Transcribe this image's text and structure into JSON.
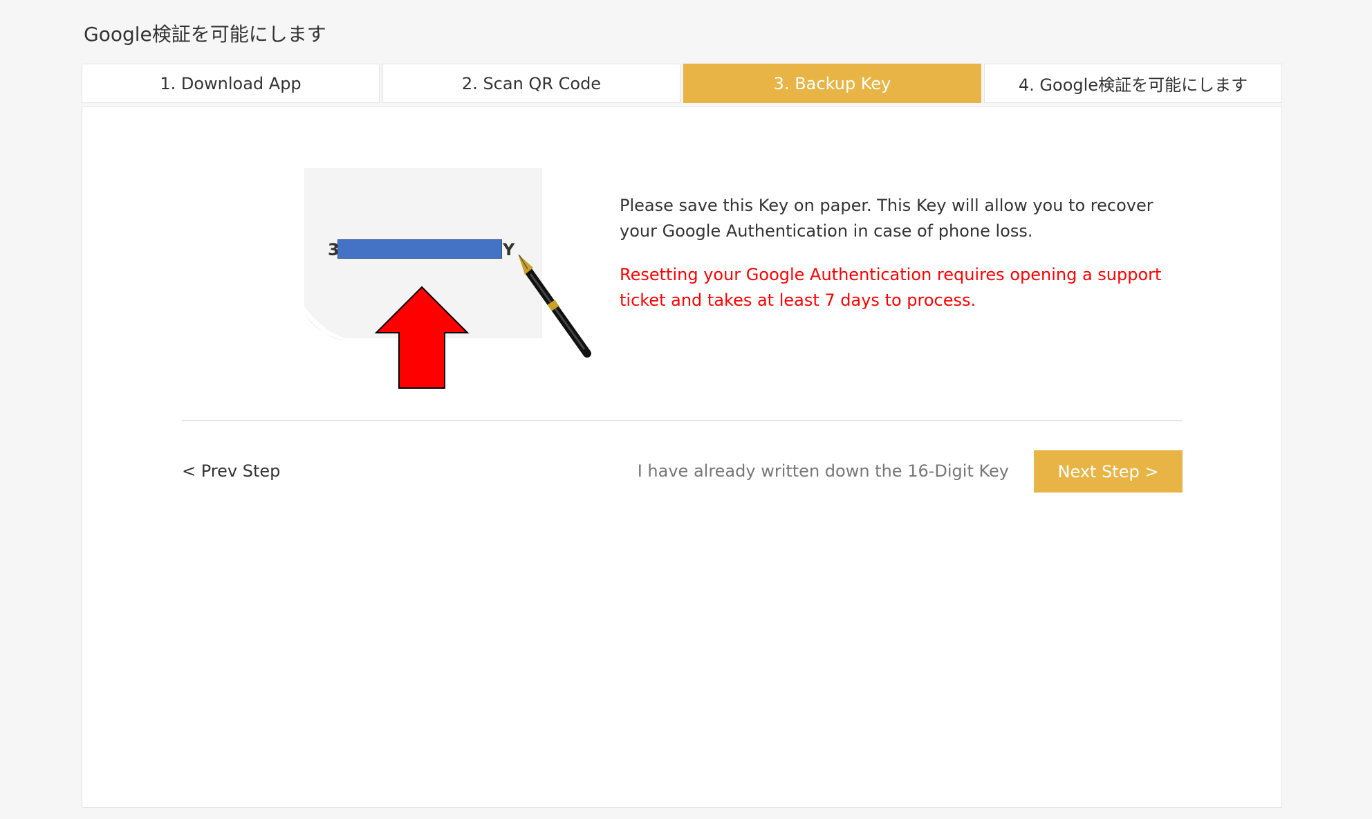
{
  "page": {
    "title": "Google検証を可能にします"
  },
  "tabs": [
    {
      "label": "1. Download App",
      "active": false
    },
    {
      "label": "2. Scan QR Code",
      "active": false
    },
    {
      "label": "3. Backup Key",
      "active": true
    },
    {
      "label": "4. Google検証を可能にします",
      "active": false
    }
  ],
  "illustration": {
    "key_prefix": "3",
    "key_suffix": "Y",
    "icons": [
      "paper-icon",
      "arrow-up-icon",
      "fountain-pen-icon"
    ]
  },
  "instructions": {
    "text": "Please save this Key on paper. This Key will allow you to recover your Google Authentication in case of phone loss.",
    "warning": "Resetting your Google Authentication requires opening a support ticket and takes at least 7 days to process."
  },
  "footer": {
    "prev_label": "< Prev Step",
    "confirm_text": "I have already written down the 16-Digit Key",
    "next_label": "Next Step >"
  },
  "colors": {
    "accent": "#e8b445",
    "warning": "#ff0000",
    "key_bar": "#4472c4",
    "arrow": "#ff0000"
  }
}
